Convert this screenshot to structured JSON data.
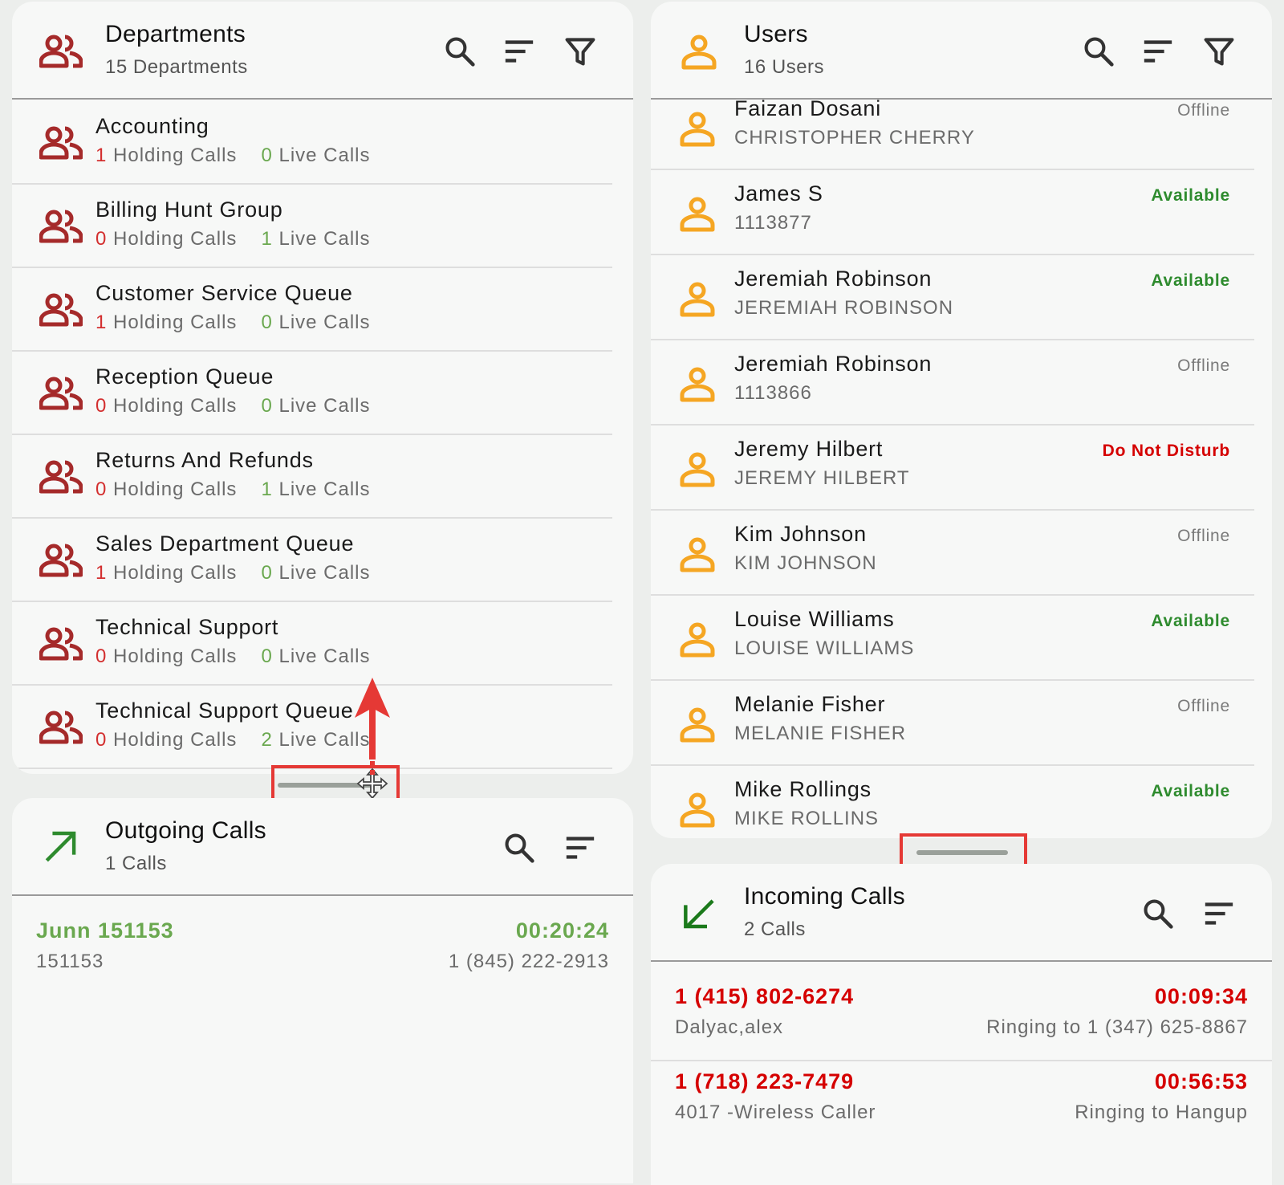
{
  "departments": {
    "title": "Departments",
    "subtitle": "15 Departments",
    "items": [
      {
        "name": "Accounting",
        "holding": "1",
        "live": "0",
        "holding_label": "Holding Calls",
        "live_label": "Live Calls"
      },
      {
        "name": "Billing Hunt Group",
        "holding": "0",
        "live": "1",
        "holding_label": "Holding Calls",
        "live_label": "Live Calls"
      },
      {
        "name": "Customer Service Queue",
        "holding": "1",
        "live": "0",
        "holding_label": "Holding Calls",
        "live_label": "Live Calls"
      },
      {
        "name": "Reception Queue",
        "holding": "0",
        "live": "0",
        "holding_label": "Holding Calls",
        "live_label": "Live Calls"
      },
      {
        "name": "Returns And Refunds",
        "holding": "0",
        "live": "1",
        "holding_label": "Holding Calls",
        "live_label": "Live Calls"
      },
      {
        "name": "Sales Department Queue",
        "holding": "1",
        "live": "0",
        "holding_label": "Holding Calls",
        "live_label": "Live Calls"
      },
      {
        "name": "Technical Support",
        "holding": "0",
        "live": "0",
        "holding_label": "Holding Calls",
        "live_label": "Live Calls"
      },
      {
        "name": "Technical Support Queue",
        "holding": "0",
        "live": "2",
        "holding_label": "Holding Calls",
        "live_label": "Live Calls"
      }
    ]
  },
  "users": {
    "title": "Users",
    "subtitle": "16 Users",
    "items": [
      {
        "name": "Faizan Dosani",
        "sub": "CHRISTOPHER CHERRY",
        "status": "Offline"
      },
      {
        "name": "James S",
        "sub": "1113877",
        "status": "Available"
      },
      {
        "name": "Jeremiah Robinson",
        "sub": "JEREMIAH ROBINSON",
        "status": "Available"
      },
      {
        "name": "Jeremiah Robinson",
        "sub": "1113866",
        "status": "Offline"
      },
      {
        "name": "Jeremy Hilbert",
        "sub": "JEREMY HILBERT",
        "status": "Do Not Disturb"
      },
      {
        "name": "Kim Johnson",
        "sub": "KIM JOHNSON",
        "status": "Offline"
      },
      {
        "name": "Louise Williams",
        "sub": "LOUISE WILLIAMS",
        "status": "Available"
      },
      {
        "name": "Melanie Fisher",
        "sub": "MELANIE FISHER",
        "status": "Offline"
      },
      {
        "name": "Mike Rollings",
        "sub": "MIKE ROLLINS",
        "status": "Available"
      }
    ]
  },
  "outgoing": {
    "title": "Outgoing Calls",
    "subtitle": "1 Calls",
    "calls": [
      {
        "name": "Junn 151153",
        "number": "151153",
        "duration": "00:20:24",
        "dest": "1 (845) 222-2913"
      }
    ]
  },
  "incoming": {
    "title": "Incoming Calls",
    "subtitle": "2 Calls",
    "calls": [
      {
        "number": "1 (415) 802-6274",
        "caller": "Dalyac,alex",
        "duration": "00:09:34",
        "dest": "Ringing to 1 (347) 625-8867"
      },
      {
        "number": "1 (718) 223-7479",
        "caller": "4017 -Wireless Caller",
        "duration": "00:56:53",
        "dest": "Ringing to Hangup"
      }
    ]
  },
  "colors": {
    "dept_icon": "#a52a2a",
    "user_icon": "#f5a623",
    "outgoing_arrow": "#2e8b2e",
    "incoming_arrow": "#1b7a1b",
    "annotation_red": "#e53935"
  },
  "icons": {
    "dept": "group-icon",
    "user": "person-icon",
    "search": "search-icon",
    "sort": "sort-icon",
    "filter": "filter-icon",
    "outgoing": "arrow-up-right-icon",
    "incoming": "arrow-down-left-icon"
  }
}
